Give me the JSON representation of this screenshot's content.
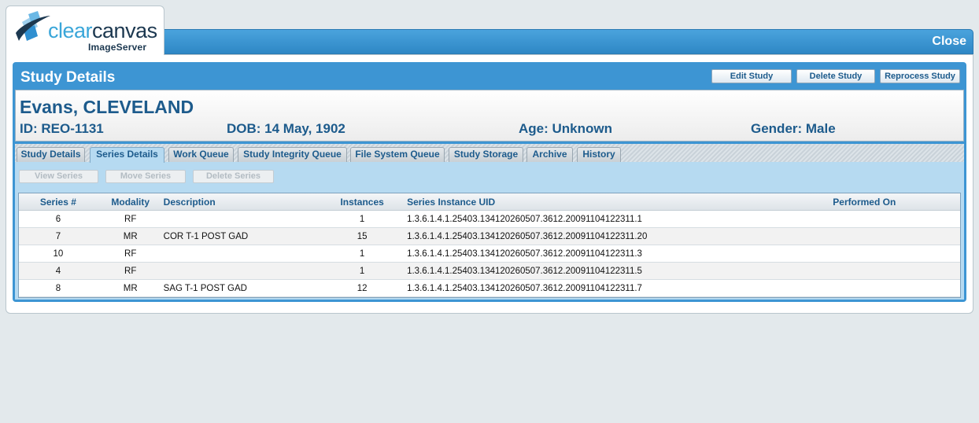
{
  "logo": {
    "brand_part1": "clear",
    "brand_part2": "canvas",
    "subtitle": "ImageServer"
  },
  "header": {
    "close_label": "Close"
  },
  "panel": {
    "title": "Study Details",
    "buttons": {
      "edit": "Edit Study",
      "delete": "Delete Study",
      "reprocess": "Reprocess Study"
    }
  },
  "patient": {
    "name": "Evans, CLEVELAND",
    "id": "ID: REO-1131",
    "dob": "DOB: 14 May, 1902",
    "age": "Age: Unknown",
    "gender": "Gender: Male"
  },
  "tabs": [
    {
      "label": "Study Details",
      "active": false
    },
    {
      "label": "Series Details",
      "active": true
    },
    {
      "label": "Work Queue",
      "active": false
    },
    {
      "label": "Study Integrity Queue",
      "active": false
    },
    {
      "label": "File System Queue",
      "active": false
    },
    {
      "label": "Study Storage",
      "active": false
    },
    {
      "label": "Archive",
      "active": false
    },
    {
      "label": "History",
      "active": false
    }
  ],
  "series_actions": {
    "view": "View Series",
    "move": "Move Series",
    "delete": "Delete Series"
  },
  "table": {
    "columns": [
      "Series #",
      "Modality",
      "Description",
      "Instances",
      "Series Instance UID",
      "Performed On"
    ],
    "rows": [
      {
        "series": "6",
        "modality": "RF",
        "description": "",
        "instances": "1",
        "uid": "1.3.6.1.4.1.25403.134120260507.3612.20091104122311.1",
        "performed": ""
      },
      {
        "series": "7",
        "modality": "MR",
        "description": "COR T-1 POST GAD",
        "instances": "15",
        "uid": "1.3.6.1.4.1.25403.134120260507.3612.20091104122311.20",
        "performed": ""
      },
      {
        "series": "10",
        "modality": "RF",
        "description": "",
        "instances": "1",
        "uid": "1.3.6.1.4.1.25403.134120260507.3612.20091104122311.3",
        "performed": ""
      },
      {
        "series": "4",
        "modality": "RF",
        "description": "",
        "instances": "1",
        "uid": "1.3.6.1.4.1.25403.134120260507.3612.20091104122311.5",
        "performed": ""
      },
      {
        "series": "8",
        "modality": "MR",
        "description": "SAG T-1 POST GAD",
        "instances": "12",
        "uid": "1.3.6.1.4.1.25403.134120260507.3612.20091104122311.7",
        "performed": ""
      }
    ]
  },
  "colors": {
    "accent": "#3d95d3",
    "text_blue": "#1d5b8c",
    "page_bg": "#e3e9ec"
  }
}
